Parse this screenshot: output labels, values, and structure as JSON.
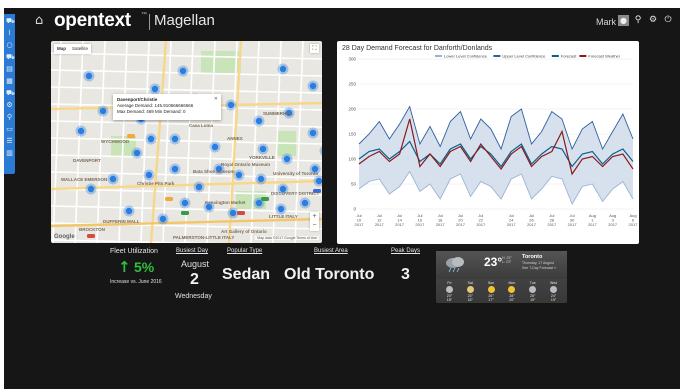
{
  "header": {
    "brand": "opentext",
    "brand_tm": "™",
    "product": "Magellan",
    "user": "Mark"
  },
  "sidebar": {
    "items": [
      "car-icon",
      "chart-icon",
      "circle-icon",
      "bus-icon",
      "table-icon",
      "grid-icon",
      "taxi-icon",
      "gears-icon",
      "map-pin-icon",
      "monitor-icon",
      "sliders-icon",
      "report-icon"
    ]
  },
  "map": {
    "tabs": [
      "Map",
      "Satellite"
    ],
    "tooltip": {
      "title": "Davenport/Christie",
      "line1": "Average Demand: 145.910666666666",
      "line2": "Max Demand: 469  Min Demand: 0"
    },
    "places": [
      "WYCHWOOD",
      "DAVENPORT",
      "WALLACE EMERSON",
      "BROCKTON",
      "LITTLE ITALY",
      "DUFFERIN MALL",
      "YORKVILLE",
      "Royal Ontario Museum",
      "Casa Loma",
      "SUMMERHILL",
      "DISCOVERY DISTRICT",
      "Kensington Market",
      "Art Gallery of Ontario",
      "Christie Pits Park",
      "University of Toronto",
      "PALMERSTON-LITTLE ITALY",
      "Bata Shoe Museum",
      "ANNEX"
    ],
    "logo": "Google",
    "attribution": "Map data ©2017 Google   Terms of Use",
    "cluster_color": "#2a7de1"
  },
  "chart_data": {
    "type": "line",
    "title": "28 Day Demand Forecast for Danforth/Donlands",
    "legend": [
      "Lower Level Confidence",
      "Upper Level Confidence",
      "Forecast",
      "Forecast Weather"
    ],
    "legend_placement": "top",
    "x": [
      "Jul 10 2017",
      "Jul 11 2017",
      "Jul 12 2017",
      "Jul 13 2017",
      "Jul 14 2017",
      "Jul 15 2017",
      "Jul 16 2017",
      "Jul 17 2017",
      "Jul 18 2017",
      "Jul 19 2017",
      "Jul 20 2017",
      "Jul 21 2017",
      "Jul 22 2017",
      "Jul 23 2017",
      "Jul 24 2017",
      "Jul 25 2017",
      "Jul 26 2017",
      "Jul 27 2017",
      "Jul 28 2017",
      "Jul 29 2017",
      "Jul 30 2017",
      "Jul 31 2017",
      "Aug 1 2017",
      "Aug 2 2017",
      "Aug 3 2017",
      "Aug 4 2017",
      "Aug 5 2017",
      "Aug 6 2017"
    ],
    "x_tick_labels": [
      "Jul\n10\n2017",
      "Jul\n12\n2017",
      "Jul\n14\n2017",
      "Jul\n16\n2017",
      "Jul\n18\n2017",
      "Jul\n20\n2017",
      "Jul\n22\n2017",
      "Jul\n24\n2017",
      "Jul\n26\n2017",
      "Jul\n28\n2017",
      "Jul\n30\n2017",
      "Aug\n1\n2017",
      "Aug\n3\n2017",
      "Aug\n6\n2017"
    ],
    "ylim": [
      0,
      300
    ],
    "yticks": [
      0,
      50,
      100,
      150,
      200,
      250,
      300
    ],
    "grid": true,
    "series": [
      {
        "name": "Lower Level Confidence",
        "color": "#9ab3d5",
        "values": [
          40,
          55,
          60,
          30,
          45,
          75,
          35,
          50,
          20,
          60,
          70,
          25,
          55,
          45,
          20,
          60,
          70,
          20,
          40,
          65,
          60,
          10,
          45,
          50,
          15,
          40,
          55,
          20
        ]
      },
      {
        "name": "Upper Level Confidence",
        "color": "#2f5f9e",
        "values": [
          130,
          150,
          175,
          140,
          170,
          205,
          130,
          165,
          125,
          175,
          195,
          140,
          180,
          160,
          120,
          185,
          200,
          130,
          155,
          195,
          180,
          120,
          160,
          175,
          120,
          155,
          190,
          140
        ]
      },
      {
        "name": "Forecast",
        "color": "#0a5f8a",
        "values": [
          100,
          115,
          120,
          100,
          115,
          135,
          95,
          110,
          90,
          120,
          130,
          100,
          125,
          110,
          85,
          115,
          130,
          90,
          110,
          125,
          120,
          85,
          110,
          115,
          90,
          110,
          120,
          95
        ]
      },
      {
        "name": "Forecast Weather",
        "color": "#8b1a1a",
        "values": [
          90,
          105,
          115,
          95,
          110,
          180,
          85,
          110,
          85,
          115,
          125,
          95,
          130,
          105,
          80,
          110,
          125,
          85,
          105,
          115,
          155,
          70,
          100,
          105,
          85,
          105,
          110,
          80
        ]
      }
    ]
  },
  "kpis": {
    "fleet_util": {
      "label": "Fleet Utilization",
      "value": "5%",
      "sub": "Increase vs. June 2016"
    },
    "busiest_day": {
      "label": "Busiest Day",
      "month": "August",
      "day": "2",
      "weekday": "Wednesday"
    },
    "popular_type": {
      "label": "Popular Type",
      "value": "Sedan"
    },
    "busiest_area": {
      "label": "Busiest Area",
      "value": "Old Toronto"
    },
    "peak_days": {
      "label": "Peak Days",
      "value": "3"
    }
  },
  "weather": {
    "temp": "23°",
    "hi": "H: 23°",
    "lo": "L: 23°",
    "city": "Toronto",
    "date": "Thursday, 17 August",
    "link": "See 7-Day Forecast »",
    "days": [
      {
        "name": "Fri",
        "icon": "cloud-icon",
        "hi": "20°",
        "lo": "18°"
      },
      {
        "name": "Sat",
        "icon": "sun-cloud-icon",
        "hi": "23°",
        "lo": "18°"
      },
      {
        "name": "Sun",
        "icon": "sun-icon",
        "hi": "26°",
        "lo": "17°"
      },
      {
        "name": "Mon",
        "icon": "sun-icon",
        "hi": "28°",
        "lo": "20°"
      },
      {
        "name": "Tue",
        "icon": "cloud-icon",
        "hi": "26°",
        "lo": "19°"
      },
      {
        "name": "Wed",
        "icon": "cloud-icon",
        "hi": "24°",
        "lo": "19°"
      }
    ]
  },
  "colors": {
    "background": "#161616",
    "sidebar": "#2b7bd4",
    "kpi_green": "#2fbf3c"
  }
}
